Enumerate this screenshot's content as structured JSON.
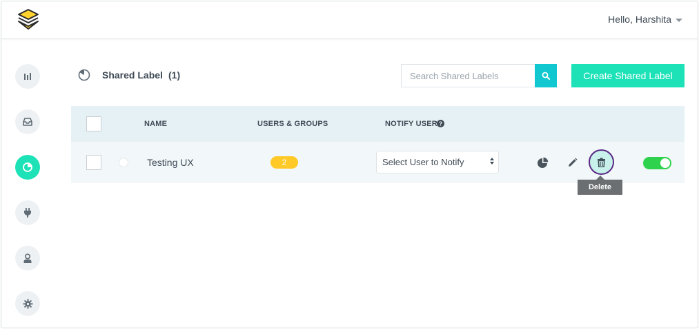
{
  "header": {
    "greeting": "Hello, Harshita",
    "logo_icon": "layers-logo-icon",
    "logo_color": "#ffd22e"
  },
  "sidebar": {
    "items": [
      {
        "name": "bar-chart",
        "icon": "bar-chart-icon",
        "active": false
      },
      {
        "name": "inbox",
        "icon": "inbox-icon",
        "active": false
      },
      {
        "name": "shared-labels",
        "icon": "pie-chart-icon",
        "active": true
      },
      {
        "name": "integrations",
        "icon": "plug-icon",
        "active": false
      },
      {
        "name": "users",
        "icon": "person-icon",
        "active": false
      },
      {
        "name": "settings",
        "icon": "gear-icon",
        "active": false
      }
    ],
    "active_color": "#1de2b8"
  },
  "page": {
    "title": "Shared Label",
    "count": "(1)",
    "search_placeholder": "Search Shared Labels",
    "create_button": "Create Shared Label"
  },
  "table": {
    "headers": {
      "name": "NAME",
      "users_groups": "USERS & GROUPS",
      "notify_user": "NOTIFY USER"
    },
    "rows": [
      {
        "name": "Testing UX",
        "users_groups_count": "2",
        "notify_select": "Select User to Notify",
        "enabled": true
      }
    ]
  },
  "tooltip": {
    "text": "Delete"
  },
  "colors": {
    "accent": "#1de2b8",
    "search_button": "#11c8d0",
    "badge": "#ffc928",
    "toggle_on": "#2fd24d",
    "delete_ring": "#5a2a86"
  }
}
